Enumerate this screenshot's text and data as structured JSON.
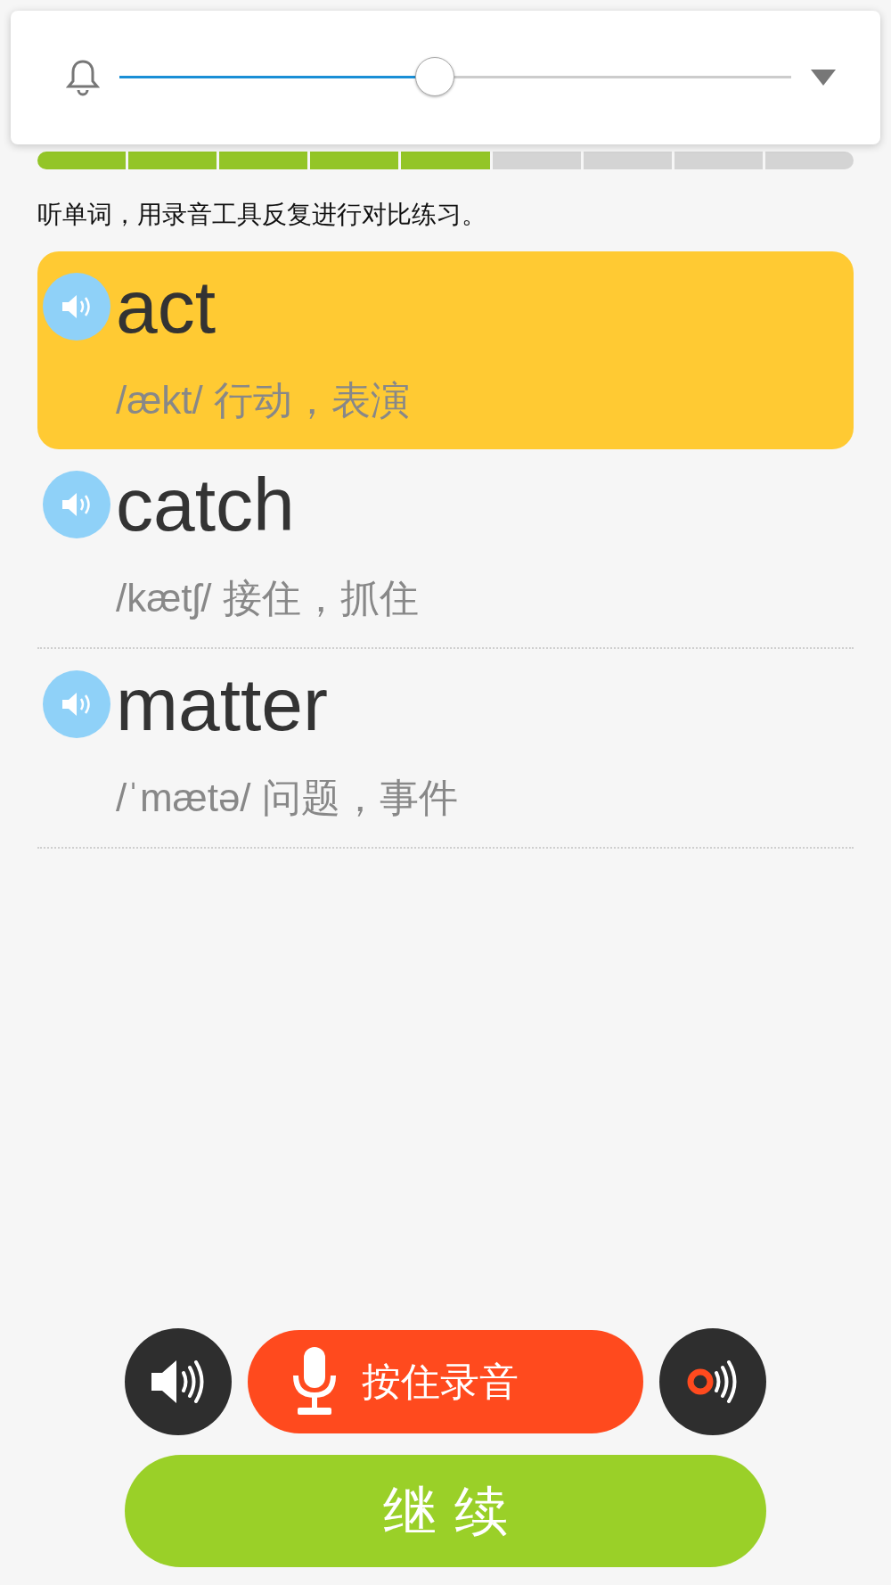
{
  "volume_popup": {
    "level": 0.47
  },
  "progress": [
    {
      "done": true
    },
    {
      "done": true
    },
    {
      "done": true
    },
    {
      "done": true
    },
    {
      "done": true
    },
    {
      "done": false
    },
    {
      "done": false
    },
    {
      "done": false
    },
    {
      "done": false
    }
  ],
  "instruction": "听单词，用录音工具反复进行对比练习。",
  "words": [
    {
      "word": "act",
      "phonetic": "/ækt/ 行动，表演",
      "selected": true
    },
    {
      "word": "catch",
      "phonetic": "/kætʃ/ 接住，抓住",
      "selected": false
    },
    {
      "word": "matter",
      "phonetic": "/ˈmætə/ 问题，事件",
      "selected": false
    }
  ],
  "record_button": "按住录音",
  "continue_button": "继 续"
}
